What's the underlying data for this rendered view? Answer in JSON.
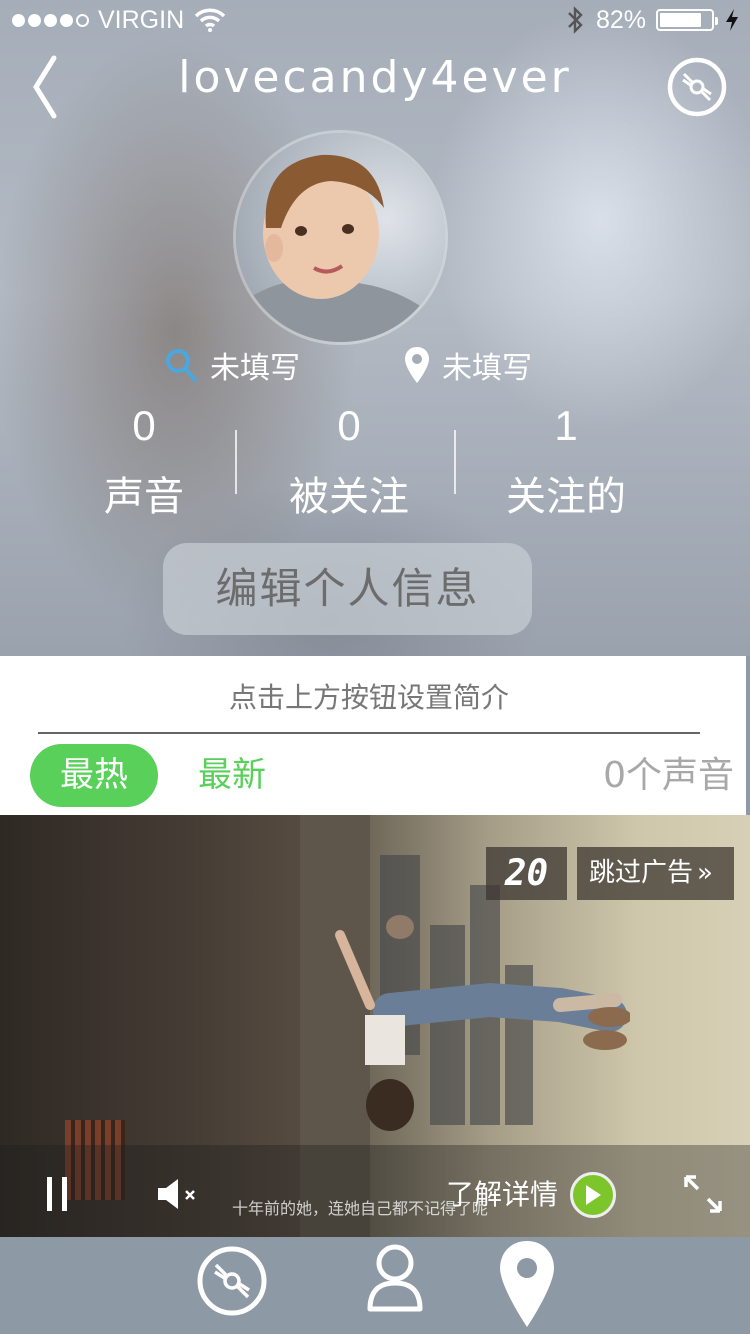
{
  "status_bar": {
    "carrier": "VIRGIN",
    "signal_bars": 4,
    "battery_percent": "82%",
    "battery_level": 0.82
  },
  "header": {
    "title": "lovecandy4ever",
    "back_icon": "chevron-left-icon",
    "right_icon": "disc-icon"
  },
  "profile": {
    "gender_text": "未填写",
    "location_text": "未填写",
    "stats": [
      {
        "value": "0",
        "label": "声音"
      },
      {
        "value": "0",
        "label": "被关注"
      },
      {
        "value": "1",
        "label": "关注的"
      }
    ],
    "edit_button": "编辑个人信息",
    "bio_placeholder": "点击上方按钮设置简介"
  },
  "tabs": {
    "hot": "最热",
    "latest": "最新",
    "count": "0个声音"
  },
  "ad": {
    "countdown": "20",
    "skip_label": "跳过广告",
    "skip_arrow": "»",
    "subtitle": "十年前的她，连她自己都不记得了呢",
    "details_label": "了解详情"
  },
  "colors": {
    "accent_green": "#58d05a",
    "tabbar_bg": "#8e99a6"
  },
  "tabbar": {
    "items": [
      "disc-icon",
      "user-icon",
      "location-pin-icon"
    ]
  }
}
